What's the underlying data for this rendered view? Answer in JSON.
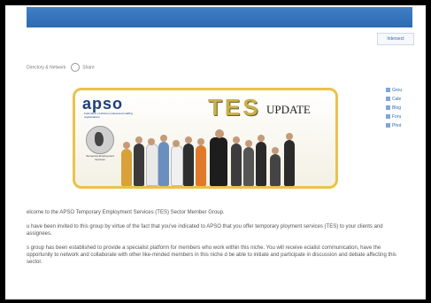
{
  "page": {
    "top_right_tab": "Intersect",
    "breadcrumb": "Directory & Network",
    "share_label": "Share"
  },
  "banner": {
    "logo_text": "apso",
    "logo_subtitle": "Federation of african professional staffing organisations",
    "emblem_caption": "Temporary Employment Services",
    "title_tes": "TES",
    "title_update": "UPDATE"
  },
  "sidebar": {
    "items": [
      {
        "label": "Grou",
        "icon": "group-icon"
      },
      {
        "label": "Cale",
        "icon": "calendar-icon"
      },
      {
        "label": "Blog",
        "icon": "blog-icon"
      },
      {
        "label": "Foru",
        "icon": "forum-icon"
      },
      {
        "label": "Phot",
        "icon": "photo-icon"
      }
    ]
  },
  "content": {
    "p1": "elcome to the APSO Temporary Employment Services (TES) Sector Member Group.",
    "p2": "u have been invited to this group by virtue of the fact that you've indicated to APSO that you offer temporary ployment services (TES) to your clients and assignees.",
    "p3": "s group has been established to provide a specialist platform for members who work within this niche. You will receive ecialist communication, have the opportunity to network and collaborate with other like-minded members in this niche d be able to initiate and participate in discussion and debate affecting this sector."
  }
}
